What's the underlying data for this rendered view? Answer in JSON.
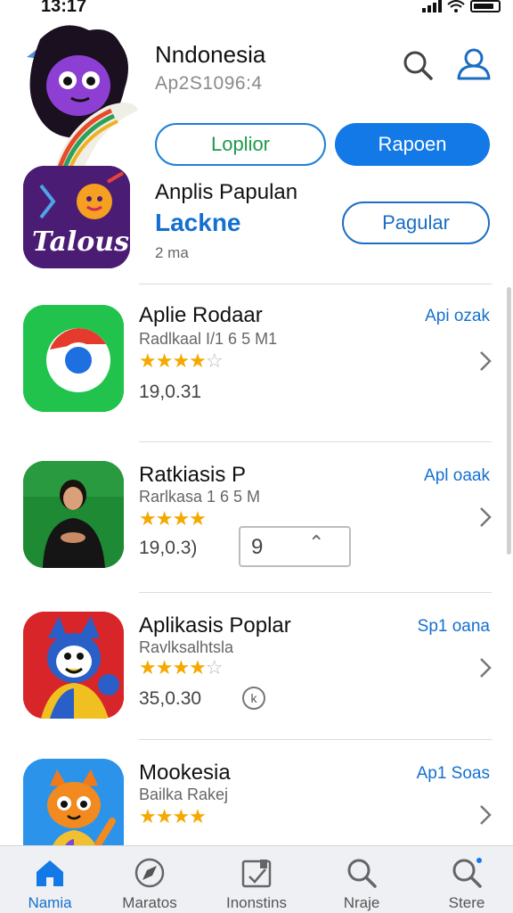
{
  "status": {
    "time": "13:17"
  },
  "header": {
    "title": "Nndonesia",
    "subtitle": "Ap2S1096:4",
    "search_icon": "search-icon",
    "profile_icon": "person-icon"
  },
  "buttons": {
    "left_pill": "Loplior",
    "right_pill": "Rapoen",
    "feature_pill": "Pagular"
  },
  "featured": {
    "title": "Anplis Papulan",
    "subtitle": "Lackne",
    "size": "2 ma",
    "icon_text": "Talous"
  },
  "apps": [
    {
      "name": "Aplie Rodaar",
      "developer": "Radlkaal I/1 6 5 M1",
      "rating": 4,
      "version": "19,0.31",
      "action": "Api ozak",
      "icon": "chrome-like-icon"
    },
    {
      "name": "Ratkiasis P",
      "developer": "Rarlkasa 1 6 5 M",
      "rating": 4,
      "version": "19,0.3)",
      "action": "Apl oaak",
      "icon": "presenter-photo-icon"
    },
    {
      "name": "Aplikasis Poplar",
      "developer": "Ravlksalhtsla",
      "rating": 4,
      "version": "35,0.30",
      "action": "Sp1 oana",
      "icon": "mascot-blue-red-icon"
    },
    {
      "name": "Mookesia",
      "developer": "Bailka Rakej",
      "rating": 4,
      "version": "",
      "action": "Ap1 Soas",
      "icon": "mascot-fox-icon"
    }
  ],
  "inline_field": {
    "value": "9",
    "mark": "⌃"
  },
  "circle_badge": "k",
  "tabs": [
    {
      "label": "Namia",
      "icon": "home-icon",
      "active": true
    },
    {
      "label": "Maratos",
      "icon": "compass-icon",
      "active": false
    },
    {
      "label": "Inonstins",
      "icon": "bookmark-box-icon",
      "active": false
    },
    {
      "label": "Nraje",
      "icon": "search-icon",
      "active": false
    },
    {
      "label": "Stere",
      "icon": "search-badge-icon",
      "active": false
    }
  ],
  "colors": {
    "accent": "#1279e6",
    "link": "#1470d0",
    "star": "#f5a800",
    "tab_bar": "#eef0f3"
  }
}
